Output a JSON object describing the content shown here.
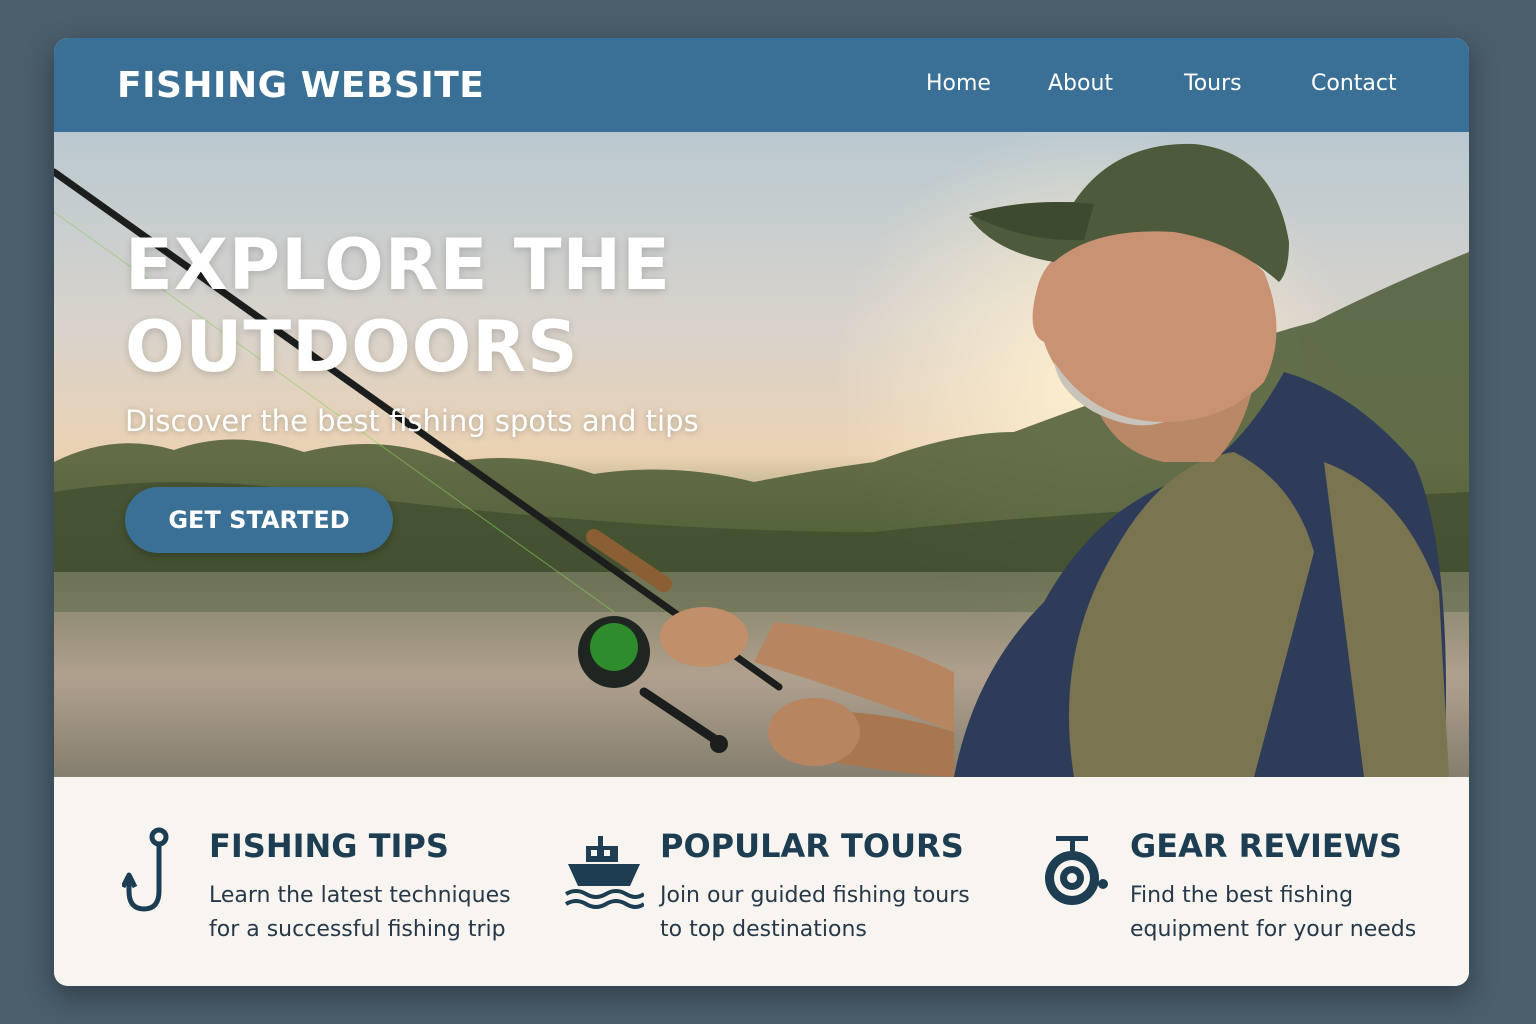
{
  "header": {
    "brand": "FISHING WEBSITE",
    "nav": [
      "Home",
      "About",
      "Tours",
      "Contact"
    ]
  },
  "hero": {
    "title": "EXPLORE THE OUTDOORS",
    "subtitle": "Discover the best fishing spots and tips",
    "cta_label": "GET STARTED"
  },
  "features": [
    {
      "icon": "fish-hook-icon",
      "title": "FISHING TIPS",
      "description": "Learn the latest techniques for a successful fishing trip"
    },
    {
      "icon": "boat-icon",
      "title": "POPULAR TOURS",
      "description": "Join our guided fishing tours to top destinations"
    },
    {
      "icon": "fishing-reel-icon",
      "title": "GEAR REVIEWS",
      "description": "Find the best fishing equipment for your needs"
    }
  ],
  "colors": {
    "primary": "#3a6f96",
    "background": "#4a5e6c",
    "feature_text": "#1d3d52",
    "panel": "#f8f5f1"
  }
}
